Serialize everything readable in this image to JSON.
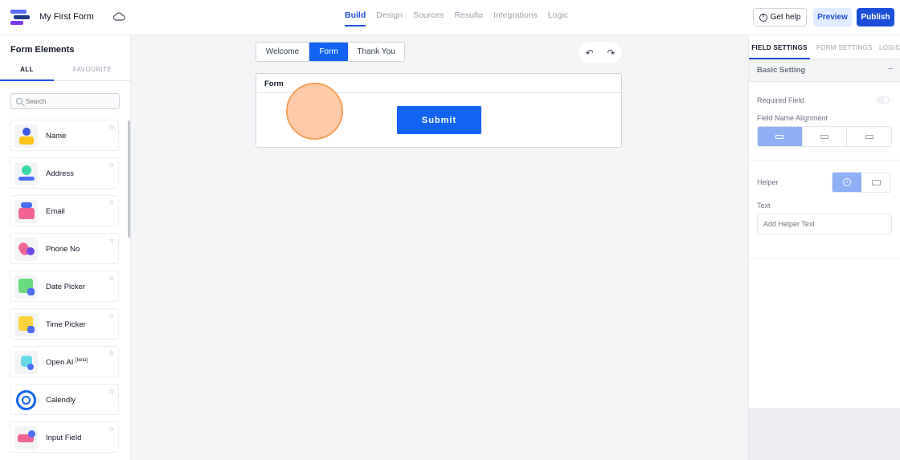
{
  "header": {
    "form_title": "My First Form",
    "nav": [
      {
        "label": "Build",
        "active": true
      },
      {
        "label": "Design",
        "active": false
      },
      {
        "label": "Sources",
        "active": false
      },
      {
        "label": "Result",
        "active": false
      },
      {
        "label": "Integrations",
        "active": false
      },
      {
        "label": "Logic",
        "active": false
      }
    ],
    "help_label": "Get help",
    "preview_label": "Preview",
    "publish_label": "Publish",
    "accent_color": "#1d4ed8"
  },
  "sidebar": {
    "title": "Form Elements",
    "tabs": [
      "ALL",
      "FAVOURITE"
    ],
    "search_placeholder": "Search",
    "items": [
      {
        "label": "Name",
        "icon": "person-icon"
      },
      {
        "label": "Address",
        "icon": "location-icon"
      },
      {
        "label": "Email",
        "icon": "mail-icon"
      },
      {
        "label": "Phone No",
        "icon": "phone-icon"
      },
      {
        "label": "Date Picker",
        "icon": "calendar-icon"
      },
      {
        "label": "Time Picker",
        "icon": "clock-icon"
      },
      {
        "label": "Open AI",
        "badge": "[beta]",
        "icon": "robot-icon"
      },
      {
        "label": "Calendly",
        "icon": "calendly-icon"
      },
      {
        "label": "Input Field",
        "icon": "input-icon"
      }
    ]
  },
  "canvas": {
    "steps": [
      "Welcome",
      "Form",
      "Thank You"
    ],
    "active_step": "Form",
    "card_title": "Form",
    "submit_label": "Submit"
  },
  "panel": {
    "tabs": [
      "FIELD SETTINGS",
      "FORM SETTINGS",
      "LOGIC"
    ],
    "section_title": "Basic Setting",
    "collapse_symbol": "–",
    "required_label": "Required Field",
    "alignment_label": "Field Name Alignment",
    "helper_label": "Helper",
    "text_label": "Text",
    "helper_placeholder": "Add Helper Text"
  }
}
